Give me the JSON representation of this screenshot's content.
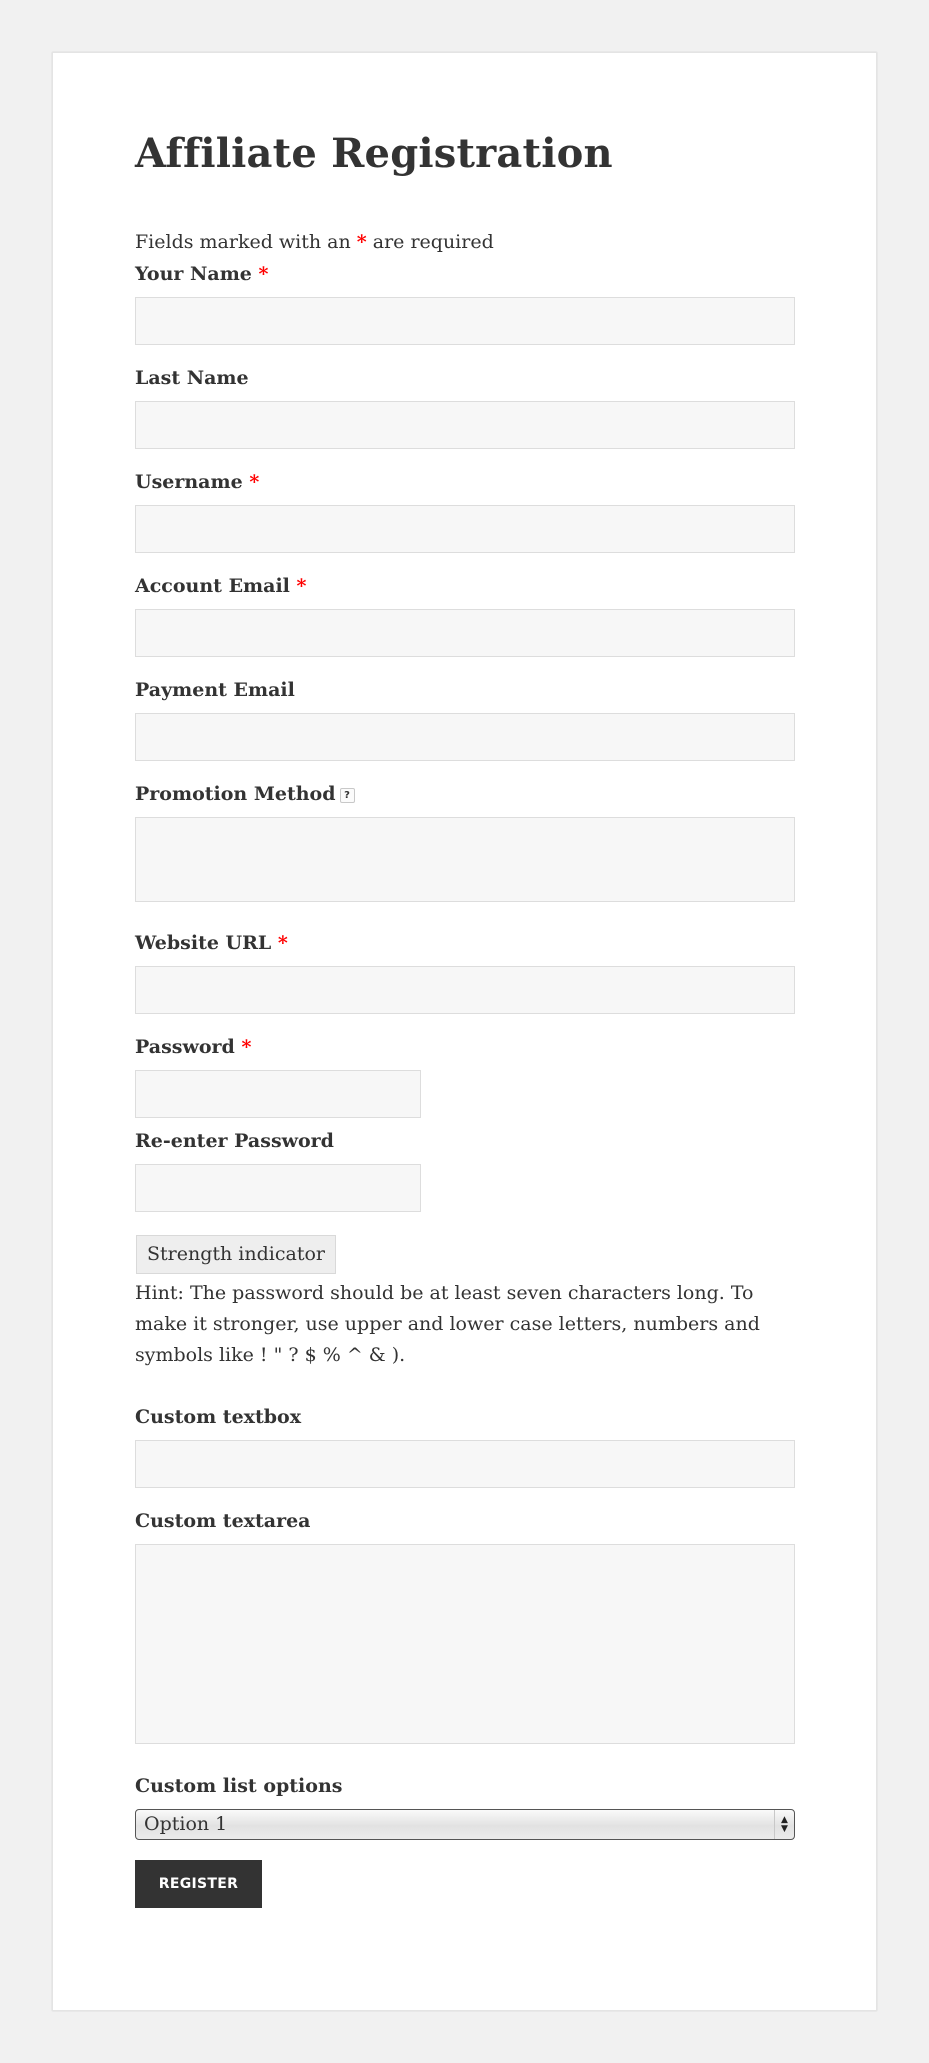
{
  "page": {
    "title": "Affiliate Registration",
    "required_note": {
      "prefix": "Fields marked with an ",
      "star": "*",
      "suffix": " are required"
    }
  },
  "colors": {
    "background": "#f1f1f1",
    "card": "#ffffff",
    "text": "#333333",
    "required_star": "#ff0000",
    "field_bg": "#f7f7f7",
    "field_border": "#dddddd",
    "button_bg": "#333333",
    "button_text": "#ffffff"
  },
  "form": {
    "required_mark": "*",
    "fields": {
      "your_name": {
        "label": "Your Name",
        "required": true,
        "value": ""
      },
      "last_name": {
        "label": "Last Name",
        "required": false,
        "value": ""
      },
      "username": {
        "label": "Username",
        "required": true,
        "value": ""
      },
      "account_email": {
        "label": "Account Email",
        "required": true,
        "value": ""
      },
      "payment_email": {
        "label": "Payment Email",
        "required": false,
        "value": ""
      },
      "promotion_method": {
        "label": "Promotion Method",
        "required": false,
        "help_icon": "help-icon",
        "help_glyph": "?",
        "value": ""
      },
      "website_url": {
        "label": "Website URL",
        "required": true,
        "value": ""
      },
      "password": {
        "label": "Password",
        "required": true,
        "value": ""
      },
      "reenter_password": {
        "label": "Re-enter Password",
        "required": false,
        "value": ""
      },
      "custom_textbox": {
        "label": "Custom textbox",
        "required": false,
        "value": ""
      },
      "custom_textarea": {
        "label": "Custom textarea",
        "required": false,
        "value": ""
      },
      "custom_list": {
        "label": "Custom list options",
        "required": false,
        "selected": "Option 1"
      }
    },
    "strength_indicator": "Strength indicator",
    "hint": "Hint: The password should be at least seven characters long. To make it stronger, use upper and lower case letters, numbers and symbols like ! \" ? $ % ^ & ).",
    "select_arrows": {
      "up": "▲",
      "down": "▼"
    },
    "register_label": "REGISTER"
  }
}
